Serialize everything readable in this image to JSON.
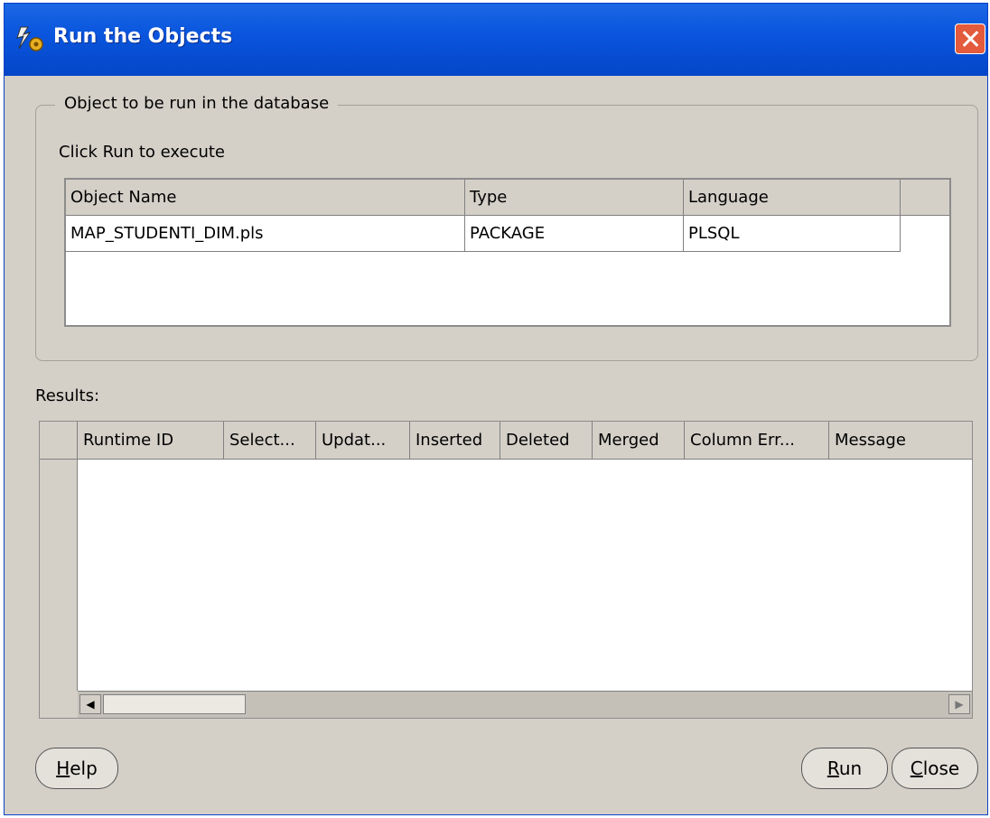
{
  "window": {
    "title": "Run the Objects"
  },
  "objects_group": {
    "legend": "Object to be run in the database",
    "instruction": "Click Run to execute",
    "columns": [
      "Object Name",
      "Type",
      "Language"
    ],
    "rows": [
      [
        "MAP_STUDENTI_DIM.pls",
        "PACKAGE",
        "PLSQL"
      ]
    ]
  },
  "results": {
    "label": "Results:",
    "columns": [
      "Runtime ID",
      "Select...",
      "Updat...",
      "Inserted",
      "Deleted",
      "Merged",
      "Column Err...",
      "Message"
    ]
  },
  "buttons": {
    "help": {
      "mnemonic": "H",
      "rest": "elp"
    },
    "run": {
      "mnemonic": "R",
      "rest": "un"
    },
    "close": {
      "mnemonic": "C",
      "rest": "lose"
    }
  }
}
